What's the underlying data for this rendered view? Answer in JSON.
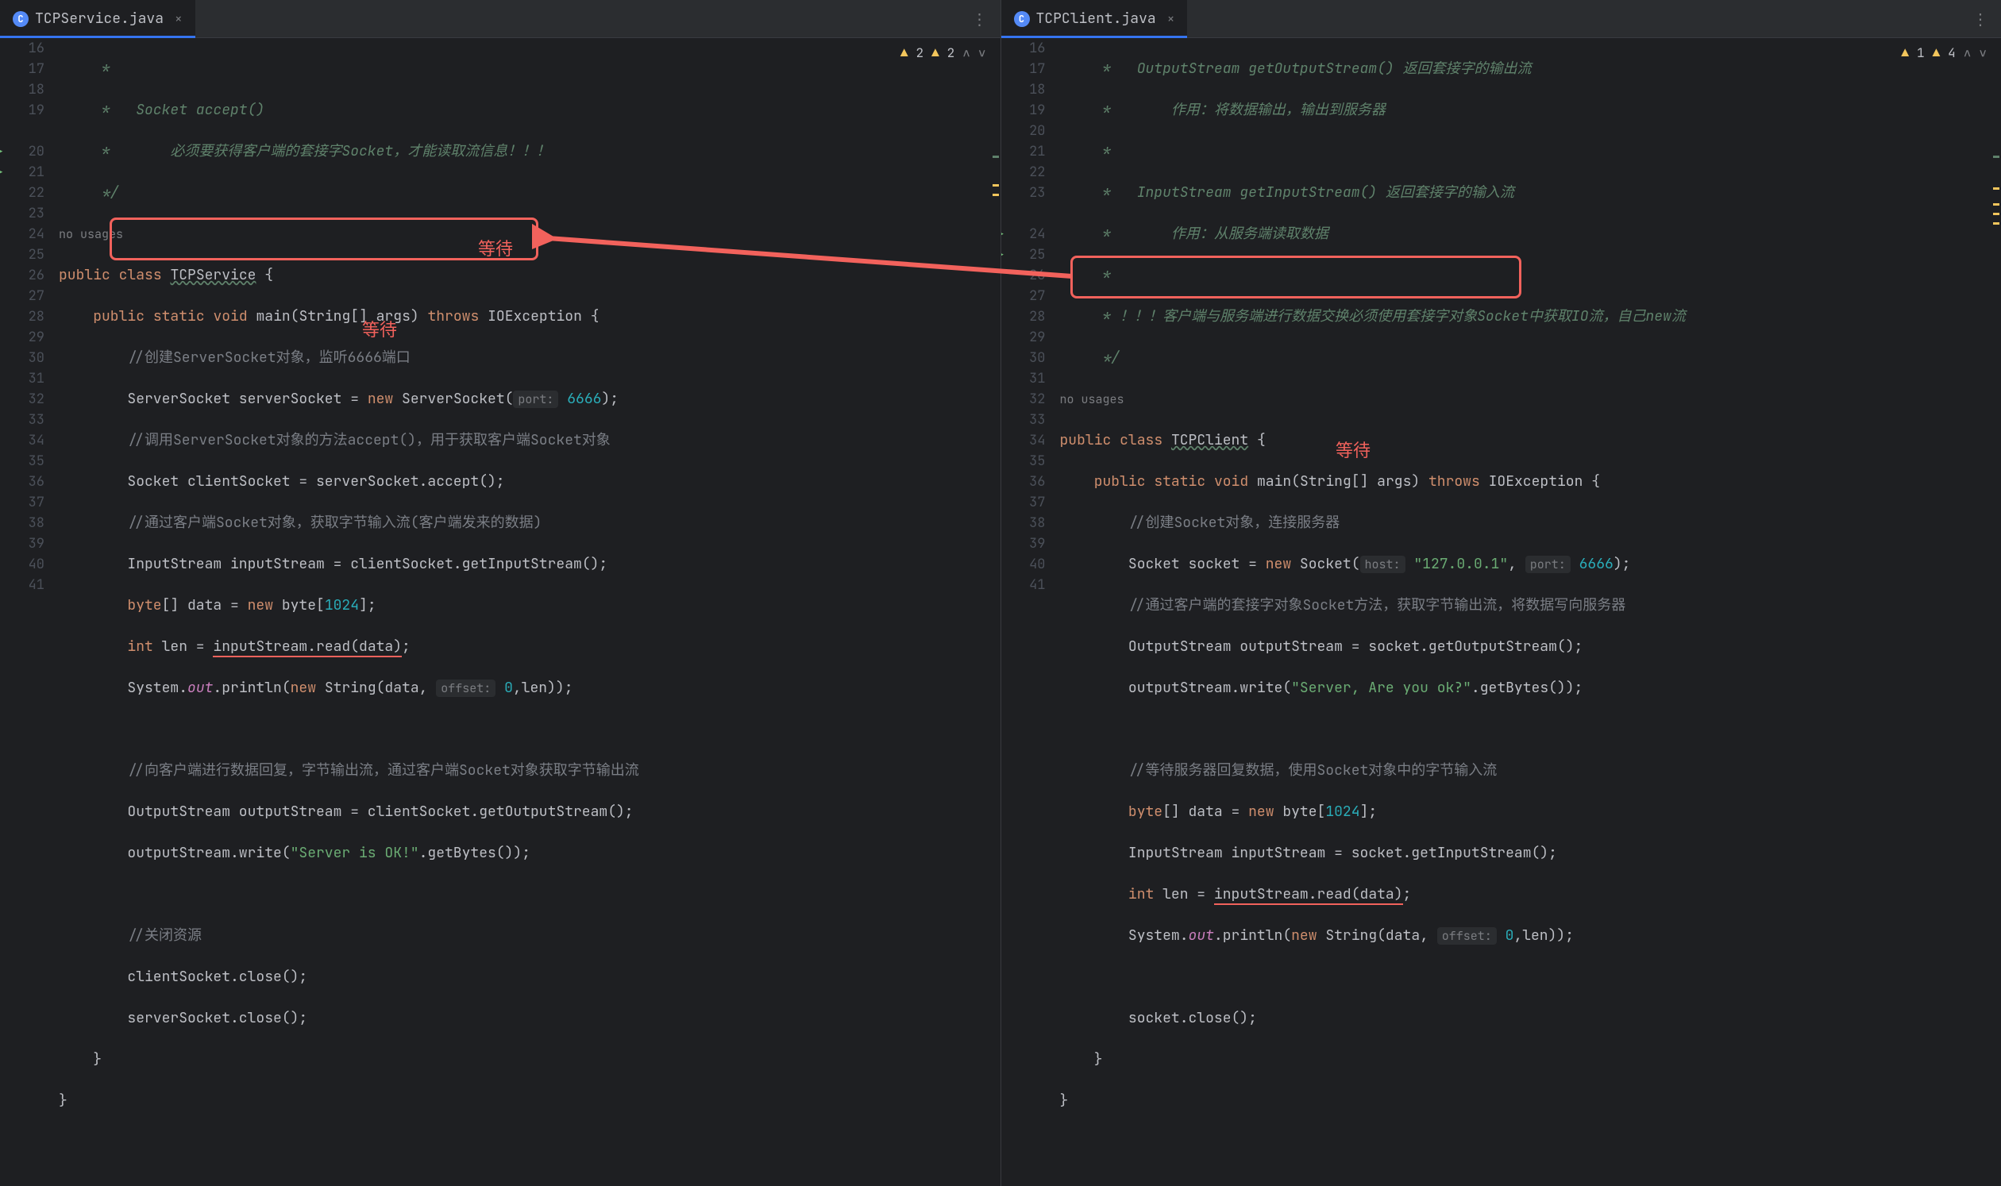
{
  "left": {
    "tab": "TCPService.java",
    "inspect": {
      "warn1": "2",
      "warn2": "2"
    },
    "lines": [
      "16",
      "17",
      "18",
      "19",
      "",
      "20",
      "21",
      "22",
      "23",
      "24",
      "25",
      "26",
      "27",
      "28",
      "29",
      "30",
      "31",
      "32",
      "33",
      "34",
      "35",
      "36",
      "37",
      "38",
      "39",
      "40",
      "41"
    ],
    "run_icons": [
      5,
      6
    ],
    "usages": "no usages",
    "c": {
      "l16a": "*",
      "l17a": "*   Socket accept()",
      "l18a": "*       必须要获得客户端的套接字Socket，才能读取流信息！！！",
      "l19a": "*/",
      "l20_public": "public",
      "l20_class": "class",
      "l20_name": "TCPService",
      "l20_brace": " {",
      "l21_public": "public",
      "l21_static": "static",
      "l21_void": "void",
      "l21_main": "main",
      "l21_sig": "(String[] args)",
      "l21_throws": "throws",
      "l21_exc": "IOException {",
      "l22": "//创建ServerSocket对象，监听6666端口",
      "l23a": "ServerSocket serverSocket = ",
      "l23_new": "new",
      "l23b": " ServerSocket(",
      "l23_hint": "port:",
      "l23_port": "6666",
      "l23c": ");",
      "l24": "//调用ServerSocket对象的方法accept()，用于获取客户端Socket对象",
      "l25": "Socket clientSocket = serverSocket.accept();",
      "l26": "//通过客户端Socket对象，获取字节输入流(客户端发来的数据)",
      "l27": "InputStream inputStream = clientSocket.getInputStream();",
      "l28a": "byte",
      "l28b": "[] data = ",
      "l28_new": "new",
      "l28c": " byte[",
      "l28_1024": "1024",
      "l28d": "];",
      "l29a": "int",
      "l29b": " len = ",
      "l29_call": "inputStream.read(data)",
      "l29c": ";",
      "l30a": "System.",
      "l30_out": "out",
      "l30b": ".println(",
      "l30_new": "new",
      "l30c": " String(data,",
      "l30_hint": "offset:",
      "l30_zero": "0",
      "l30d": ",len));",
      "l32": "//向客户端进行数据回复，字节输出流，通过客户端Socket对象获取字节输出流",
      "l33": "OutputStream outputStream = clientSocket.getOutputStream();",
      "l34a": "outputStream.write(",
      "l34_str": "\"Server is OK!\"",
      "l34b": ".getBytes());",
      "l36": "//关闭资源",
      "l37": "clientSocket.close();",
      "l38": "serverSocket.close();",
      "l39": "}",
      "l40": "}",
      "wait1": "等待",
      "wait2": "等待"
    }
  },
  "right": {
    "tab": "TCPClient.java",
    "inspect": {
      "warn1": "1",
      "warn2": "4"
    },
    "lines": [
      "16",
      "17",
      "18",
      "19",
      "20",
      "21",
      "22",
      "23",
      "",
      "24",
      "25",
      "26",
      "27",
      "28",
      "29",
      "30",
      "31",
      "32",
      "33",
      "34",
      "35",
      "36",
      "37",
      "38",
      "39",
      "40",
      "41"
    ],
    "run_icons": [
      9,
      10
    ],
    "usages": "no usages",
    "c": {
      "l16": "*   OutputStream getOutputStream() 返回套接字的输出流",
      "l17": "*       作用：将数据输出，输出到服务器",
      "l18": "*",
      "l19": "*   InputStream getInputStream() 返回套接字的输入流",
      "l20": "*       作用：从服务端读取数据",
      "l21": "*",
      "l22": "* ！！！客户端与服务端进行数据交换必须使用套接字对象Socket中获取IO流，自己new流",
      "l23": "*/",
      "l24_public": "public",
      "l24_class": "class",
      "l24_name": "TCPClient",
      "l24_brace": " {",
      "l25_public": "public",
      "l25_static": "static",
      "l25_void": "void",
      "l25_main": "main",
      "l25_sig": "(String[] args)",
      "l25_throws": "throws",
      "l25_exc": "IOException {",
      "l26": "//创建Socket对象，连接服务器",
      "l27a": "Socket socket = ",
      "l27_new": "new",
      "l27b": " Socket(",
      "l27_h1": "host:",
      "l27_host": "\"127.0.0.1\"",
      "l27c": ",",
      "l27_h2": "port:",
      "l27_port": "6666",
      "l27d": ");",
      "l28": "//通过客户端的套接字对象Socket方法，获取字节输出流，将数据写向服务器",
      "l29": "OutputStream outputStream = socket.getOutputStream();",
      "l30a": "outputStream.write(",
      "l30_str": "\"Server, Are you ok?\"",
      "l30b": ".getBytes());",
      "l32": "//等待服务器回复数据，使用Socket对象中的字节输入流",
      "l33a": "byte",
      "l33b": "[] data = ",
      "l33_new": "new",
      "l33c": " byte[",
      "l33_1024": "1024",
      "l33d": "];",
      "l34": "InputStream inputStream = socket.getInputStream();",
      "l35a": "int",
      "l35b": " len = ",
      "l35_call": "inputStream.read(data)",
      "l35c": ";",
      "l36a": "System.",
      "l36_out": "out",
      "l36b": ".println(",
      "l36_new": "new",
      "l36c": " String(data,",
      "l36_hint": "offset:",
      "l36_zero": "0",
      "l36d": ",len));",
      "l38": "socket.close();",
      "l39": "}",
      "l40": "}",
      "wait": "等待"
    }
  }
}
